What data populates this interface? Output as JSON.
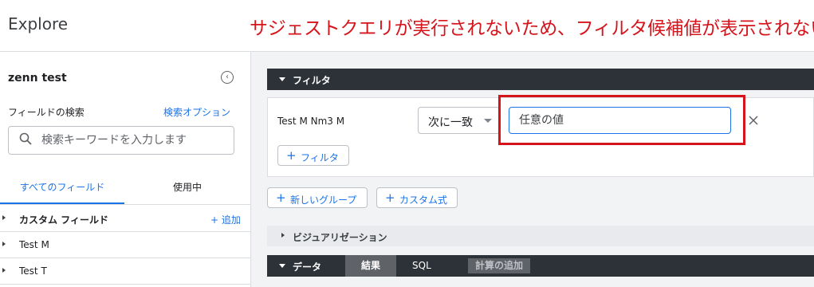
{
  "header": {
    "app_title": "Explore",
    "annotation": "サジェストクエリが実行されないため、フィルタ候補値が表示されない"
  },
  "sidebar": {
    "model_name": "zenn test",
    "field_search_label": "フィールドの検索",
    "search_options_link": "検索オプション",
    "search_placeholder": "検索キーワードを入力します",
    "tabs": [
      {
        "label": "すべてのフィールド",
        "active": true
      },
      {
        "label": "使用中",
        "active": false
      }
    ],
    "custom_fields_label": "カスタム フィールド",
    "add_label": "+ 追加",
    "views": [
      {
        "label": "Test M"
      },
      {
        "label": "Test T"
      }
    ]
  },
  "filters": {
    "section_label": "フィルタ",
    "rows": [
      {
        "field": "Test M Nm3 M",
        "match_type": "次に一致",
        "value_placeholder": "任意の値"
      }
    ],
    "add_filter_label": "フィルタ"
  },
  "actions": {
    "new_group_label": "新しいグループ",
    "custom_expression_label": "カスタム式"
  },
  "visualization": {
    "label": "ビジュアリゼーション"
  },
  "data": {
    "section_label": "データ",
    "tabs": [
      {
        "label": "結果",
        "active": true
      },
      {
        "label": "SQL",
        "active": false
      }
    ],
    "add_calculation_label": "計算の追加"
  },
  "colors": {
    "accent": "#1a73e8",
    "annotation_red": "#d6141c",
    "dark_bar": "#2d3238"
  }
}
